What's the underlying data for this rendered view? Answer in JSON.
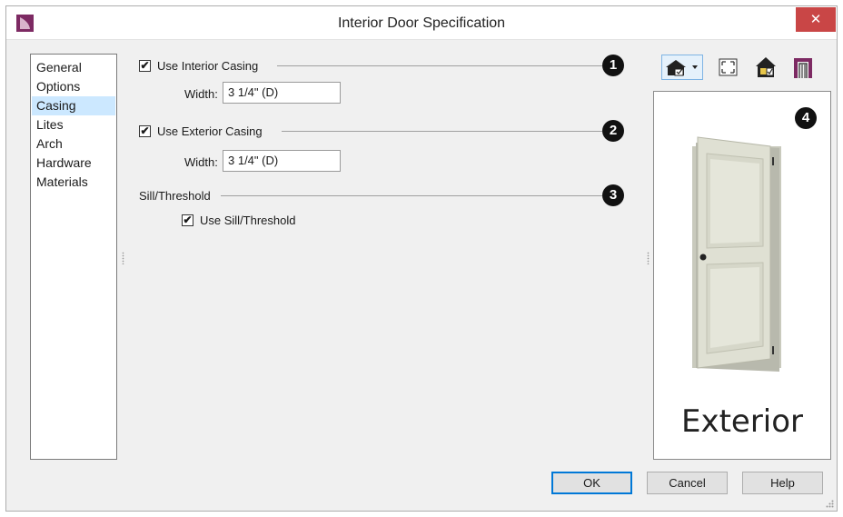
{
  "window": {
    "title": "Interior Door Specification",
    "close_glyph": "✕"
  },
  "nav": {
    "items": [
      {
        "label": "General"
      },
      {
        "label": "Options"
      },
      {
        "label": "Casing",
        "selected": true
      },
      {
        "label": "Lites"
      },
      {
        "label": "Arch"
      },
      {
        "label": "Hardware"
      },
      {
        "label": "Materials"
      }
    ]
  },
  "casing": {
    "interior": {
      "checked": true,
      "label": "Use Interior Casing",
      "width_label": "Width:",
      "width_value": "3 1/4\" (D)",
      "callout": "1"
    },
    "exterior": {
      "checked": true,
      "label": "Use Exterior Casing",
      "width_label": "Width:",
      "width_value": "3 1/4\" (D)",
      "callout": "2"
    },
    "sill": {
      "section_label": "Sill/Threshold",
      "checkbox_label": "Use Sill/Threshold",
      "checked": true,
      "callout": "3"
    }
  },
  "preview": {
    "label": "Exterior",
    "callout": "4"
  },
  "toolbar": {
    "icons": [
      "view-options-icon",
      "fill-window-icon",
      "show-room-icon",
      "show-casing-icon"
    ]
  },
  "buttons": {
    "ok": "OK",
    "cancel": "Cancel",
    "help": "Help"
  },
  "check_glyph": "✔",
  "colors": {
    "close": "#c94646",
    "selected_nav": "#cce8ff",
    "default_button_border": "#0078d7",
    "door": "#dfe0d3",
    "app_icon": "#7d2a63"
  }
}
